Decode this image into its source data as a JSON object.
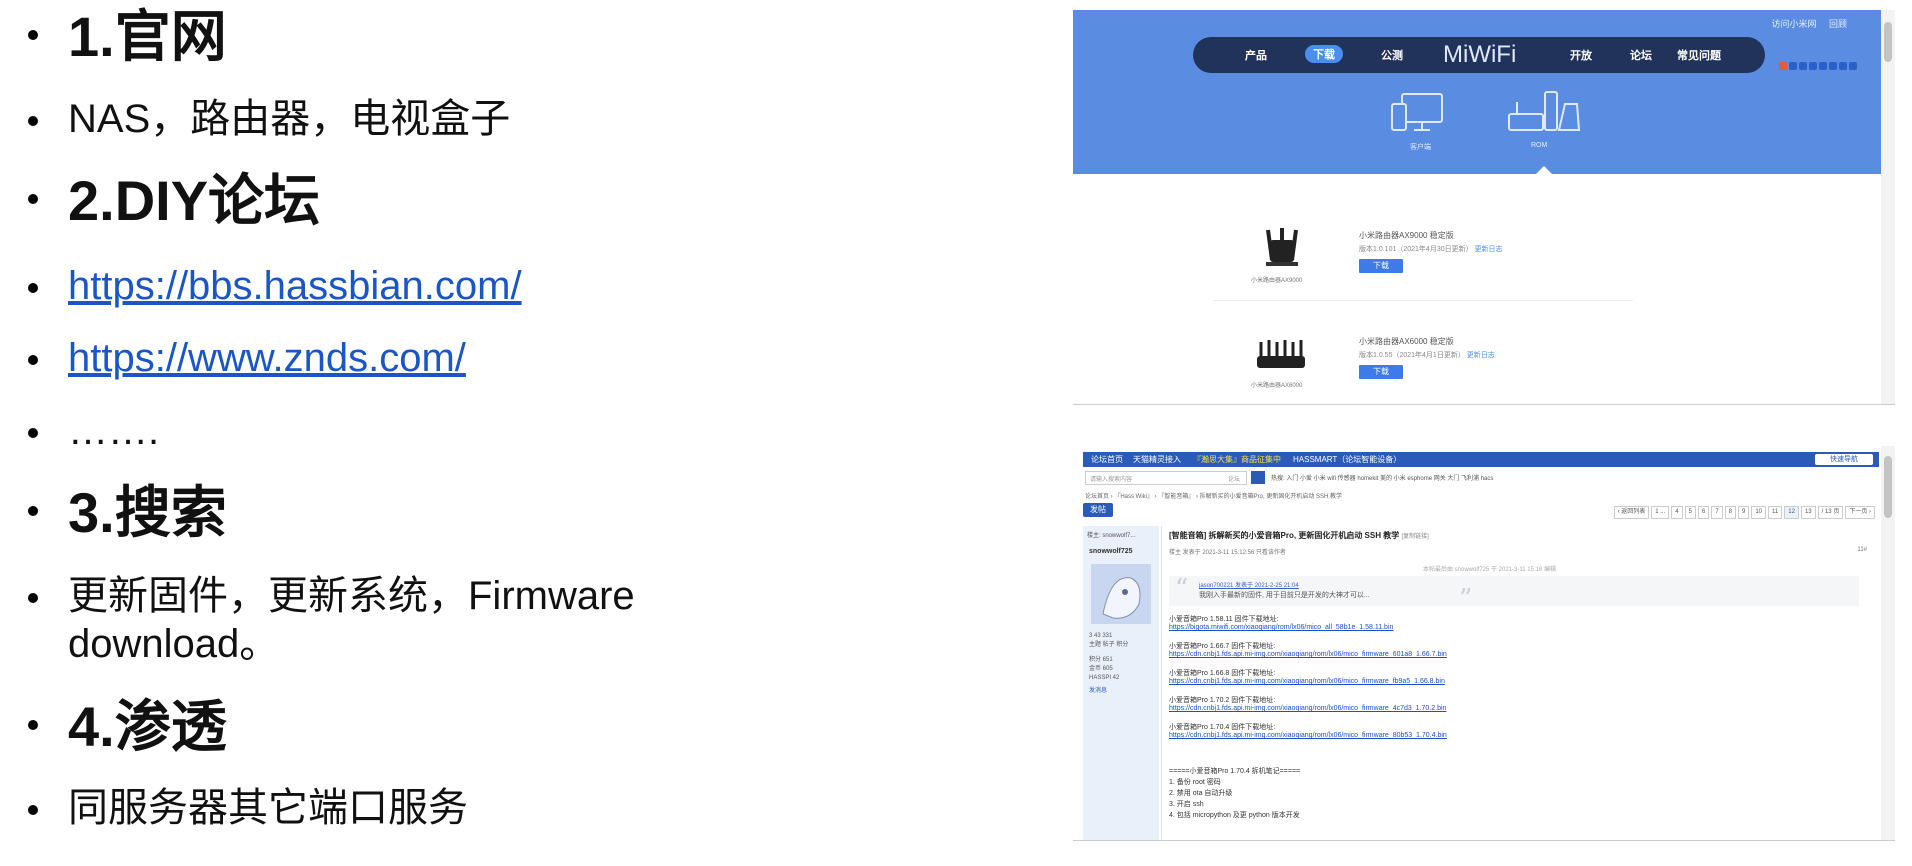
{
  "bullets": {
    "h1": "1.官网",
    "t1": "NAS，路由器，电视盒子",
    "h2": "2.DIY论坛",
    "link1": "https://bbs.hassbian.com/",
    "link2": "https://www.znds.com/",
    "ellipsis": "…….",
    "h3": "3.搜索",
    "t3_line1": "更新固件，更新系统，Firmware",
    "t3_line2": "download。",
    "h4": "4.渗透",
    "t4": "同服务器其它端口服务"
  },
  "miwifi": {
    "top_links": [
      "访问小米网",
      "回顾"
    ],
    "nav": [
      "产品",
      "下载",
      "公测",
      "开放",
      "论坛",
      "常见问题"
    ],
    "logo": "MiWiFi",
    "device_labels": [
      "客户端",
      "ROM"
    ],
    "products": [
      {
        "name": "小米路由器AX9000 稳定版",
        "version": "版本1.0.101（2021年4月30日更新）",
        "changelog": "更新日志",
        "download": "下载",
        "caption": "小米路由器AX9000"
      },
      {
        "name": "小米路由器AX6000 稳定版",
        "version": "版本1.0.55（2021年4月1日更新）",
        "changelog": "更新日志",
        "download": "下载",
        "caption": "小米路由器AX6000"
      }
    ],
    "colors": {
      "band": "#5a8ce2",
      "nav": "#21335a",
      "button": "#3d7be8"
    }
  },
  "forum": {
    "nav": [
      "论坛首页",
      "天猫精灵接入",
      "『瀚思大集』商品征集中",
      "HASSMART（论坛智能设备）"
    ],
    "nav_button": "快速导航",
    "search_placeholder": "请输入搜索内容",
    "search_type": "论坛",
    "hot": "热搜: 入门 小爱 小米 wifi 传感器 homekit 美的 小米 esphome 网关 大门 飞利浦 hacs",
    "breadcrumb": "论坛首页 › 『Hass Wiki』 › 『智能音箱』 › 拆解新买的小爱音箱Pro, 更新固化开机启动 SSH 教学",
    "post_button": "发帖",
    "pages": [
      "‹ 返回列表",
      "1 ...",
      "4",
      "5",
      "6",
      "7",
      "8",
      "9",
      "10",
      "11",
      "12",
      "13",
      "/ 13 页",
      "下一页 ›"
    ],
    "author": "snowwolf725",
    "author_top": "楼主: snowwolf7...",
    "author_stats": [
      "3  43  331",
      "主题  帖子  积分",
      "积分 651",
      "金币 605",
      "HASSPI 42",
      "发消息"
    ],
    "title": "[智能音箱] 拆解新买的小爱音箱Pro, 更新固化开机启动 SSH 教学",
    "title_sub": "[复制链接]",
    "meta": "楼主  发表于 2021-3-11 15:12:56  只看该作者",
    "floor": "11#",
    "edited": "本帖最后由 snowwolf725 于 2021-3-11 15:16 编辑",
    "quote_author": "jason700221 发表于 2021-2-25 21:04",
    "quote_text": "我刚入手最新的固件, 用于目前只是开发的大神才可以...",
    "lines": [
      {
        "text": "小爱音箱Pro 1.58.11 固件下载地址:",
        "link": "https://bigota.miwifi.com/xiaoqiang/rom/lx06/mico_all_58b1e_1.58.11.bin"
      },
      {
        "text": "小爱音箱Pro 1.66.7 固件下载地址:",
        "link": "https://cdn.cnbj1.fds.api.mi-img.com/xiaoqiang/rom/lx06/mico_firmware_601a8_1.66.7.bin"
      },
      {
        "text": "小爱音箱Pro 1.66.8 固件下载地址:",
        "link": "https://cdn.cnbj1.fds.api.mi-img.com/xiaoqiang/rom/lx06/mico_firmware_fb9a5_1.66.8.bin"
      },
      {
        "text": "小爱音箱Pro 1.70.2 固件下载地址:",
        "link": "https://cdn.cnbj1.fds.api.mi-img.com/xiaoqiang/rom/lx06/mico_firmware_4c7d3_1.70.2.bin"
      },
      {
        "text": "小爱音箱Pro 1.70.4 固件下载地址:",
        "link": "https://cdn.cnbj1.fds.api.mi-img.com/xiaoqiang/rom/lx06/mico_firmware_80b53_1.70.4.bin"
      }
    ],
    "steps": [
      "=====小爱音箱Pro 1.70.4 拆机笔记=====",
      "1. 备份 root 密码",
      "2. 禁用 ota 自动升级",
      "3. 开启 ssh",
      "4. 包括 micropython 及更 python 版本开发"
    ]
  }
}
